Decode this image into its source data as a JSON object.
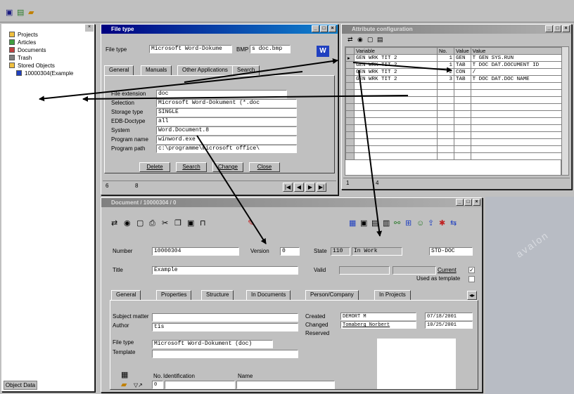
{
  "toolbar": {
    "icons": [
      "new-icon",
      "open-icon",
      "folder-icon"
    ]
  },
  "tree": {
    "items": [
      {
        "label": "Projects",
        "icon": "folder-icon"
      },
      {
        "label": "Articles",
        "icon": "folder-icon"
      },
      {
        "label": "Documents",
        "icon": "folder-icon"
      },
      {
        "label": "Trash",
        "icon": "trash-icon"
      },
      {
        "label": "Stored Objects",
        "icon": "folder-icon"
      },
      {
        "label": "10000304(Example",
        "icon": "word-doc-icon"
      }
    ],
    "footer_tab": "Object Data"
  },
  "filetype": {
    "title": "File type",
    "filetype_label": "File type",
    "filetype_value": "Microsoft Word-Dokume",
    "bmp_label": "BMP",
    "bmp_value": "s doc.bmp",
    "tabs": [
      "General",
      "Manuals",
      "Other Applications",
      "Search"
    ],
    "rows": [
      {
        "label": "File extension",
        "value": "doc"
      },
      {
        "label": "Selection",
        "value": "Microsoft Word-Dokument (*.doc"
      },
      {
        "label": "Storage type",
        "value": "SINGLE"
      },
      {
        "label": "EDB-Doctype",
        "value": "all"
      },
      {
        "label": "System",
        "value": "Word.Document.8"
      },
      {
        "label": "Program name",
        "value": "winword.exe"
      },
      {
        "label": "Program path",
        "value": "c:\\programme\\microsoft office\\"
      }
    ],
    "buttons": [
      "Delete",
      "Search",
      "Change",
      "Close"
    ],
    "status_left": "6",
    "status_mid": "8"
  },
  "attrs": {
    "title": "Attribute configuration",
    "headers": [
      "Variable",
      "No.",
      "Value",
      "Value"
    ],
    "rows": [
      {
        "var": "GEN WRK TIT 2",
        "no": "1",
        "v1": "GEN",
        "v2": "T GEN SYS.RUN"
      },
      {
        "var": "GEN WRK TIT 2",
        "no": "1",
        "v1": "TAB",
        "v2": "T DOC DAT.DOCUMENT ID"
      },
      {
        "var": "GEN WRK TIT 2",
        "no": "2",
        "v1": "CON",
        "v2": "/"
      },
      {
        "var": "GEN WRK TIT 2",
        "no": "3",
        "v1": "TAB",
        "v2": "T DOC DAT.DOC NAME"
      }
    ],
    "status_left": "1",
    "status_mid": "4"
  },
  "document": {
    "title": "Document / 10000304 / 0",
    "number_label": "Number",
    "number_value": "10000304",
    "version_label": "Version",
    "version_value": "0",
    "state_label": "State",
    "state_code": "110",
    "state_value": "In Work",
    "state_type": "STD-DOC",
    "title_label": "Title",
    "title_value": "Example",
    "valid_label": "Valid",
    "current_label": "Current",
    "template_label": "Used as template",
    "tabs": [
      "General",
      "Properties",
      "Structure",
      "In Documents",
      "Person/Company",
      "In Projects"
    ],
    "subject_label": "Subject matter",
    "author_label": "Author",
    "author_value": "tis",
    "filetype_label": "File type",
    "filetype_value": "Microsoft Word-Dokument (doc)",
    "template_field_label": "Template",
    "created_label": "Created",
    "changed_label": "Changed",
    "reserved_label": "Reserved",
    "created_by": "DEMORT M",
    "created_date": "07/18/2001",
    "changed_by": "Tomaberg Norbert",
    "changed_date": "10/25/2001",
    "list_headers": [
      "No.",
      "Identification",
      "Name"
    ],
    "list_row_no": "0"
  },
  "watermark": "avalon"
}
